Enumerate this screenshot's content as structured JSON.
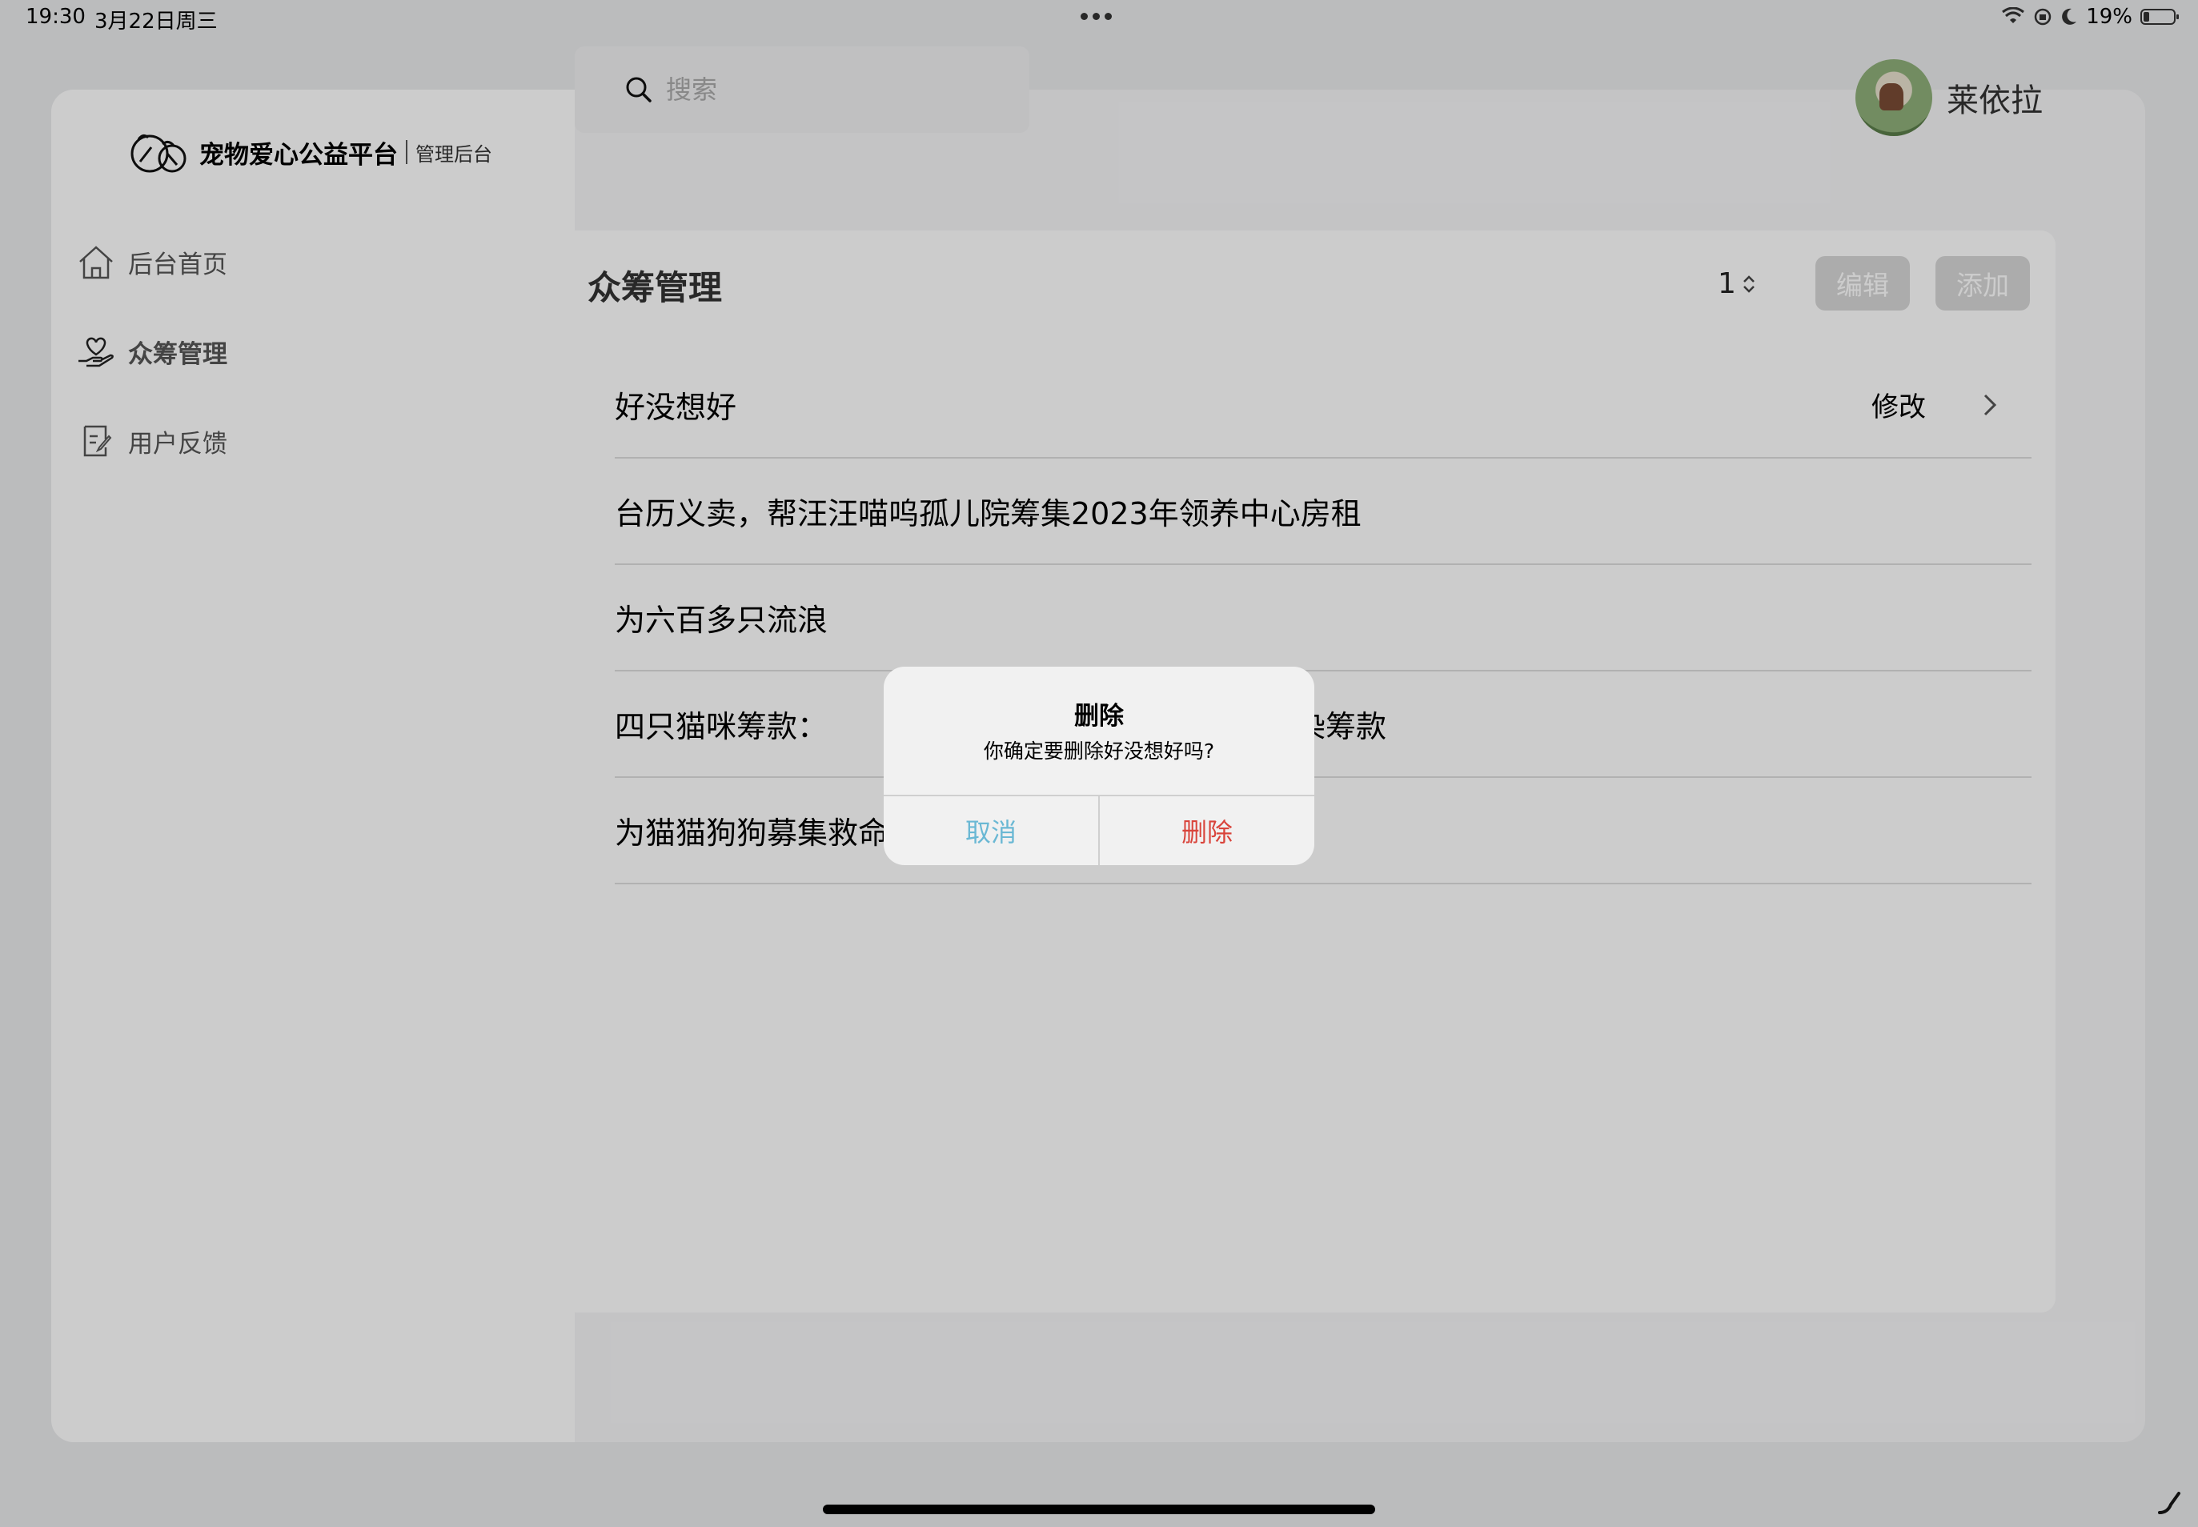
{
  "status_bar": {
    "time": "19:30",
    "date": "3月22日周三",
    "battery": "19%",
    "battery_level": 0.19
  },
  "app": {
    "brand_name": "宠物爱心公益平台",
    "brand_sub": "管理后台"
  },
  "sidebar": {
    "items": [
      {
        "label": "后台首页",
        "icon": "home-icon"
      },
      {
        "label": "众筹管理",
        "icon": "heart-hand-icon",
        "active": true
      },
      {
        "label": "用户反馈",
        "icon": "feedback-icon"
      }
    ]
  },
  "search": {
    "placeholder": "搜索"
  },
  "user": {
    "name": "莱依拉"
  },
  "panel": {
    "title": "众筹管理",
    "page": "1",
    "edit_label": "编辑",
    "add_label": "添加",
    "rows": [
      {
        "title": "好没想好",
        "action": "修改"
      },
      {
        "title": "台历义卖，帮汪汪喵呜孤儿院筹集2023年领养中心房租"
      },
      {
        "title": "为六百多只流浪"
      },
      {
        "title": "四只猫咪筹款：",
        "title_tail": "感染筹款"
      },
      {
        "title": "为猫猫狗狗募集救命钱"
      }
    ]
  },
  "dialog": {
    "title": "删除",
    "message": "你确定要删除好没想好吗?",
    "cancel_label": "取消",
    "delete_label": "删除",
    "cancel_color": "#6ab8d4",
    "delete_color": "#d9443b"
  }
}
